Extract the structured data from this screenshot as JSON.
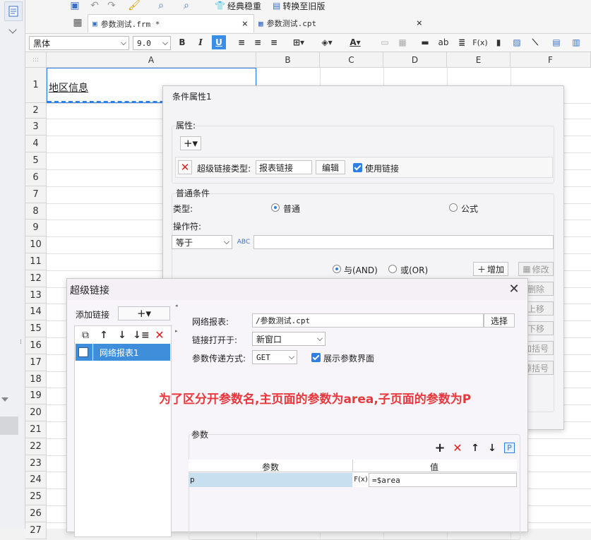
{
  "toolbar": {
    "stable_label": "经典稳重",
    "convert_label": "转换至旧版",
    "tabs": [
      {
        "label": "参数测试.frm *",
        "close": "×"
      },
      {
        "label": "参数测试.cpt",
        "close": "×"
      }
    ]
  },
  "format_bar": {
    "font": "黑体",
    "size": "9.0",
    "bold": "B",
    "italic": "I",
    "underline": "U",
    "ab": "ab",
    "fx": "F(x)"
  },
  "sheet": {
    "corner": ":::",
    "columns": [
      "A",
      "B",
      "C",
      "D",
      "E",
      "F"
    ],
    "rows": [
      "1",
      "2",
      "3",
      "4",
      "5",
      "6",
      "7",
      "8",
      "9",
      "10",
      "11",
      "12",
      "13",
      "14",
      "15",
      "16",
      "17",
      "18",
      "19",
      "20",
      "21",
      "22",
      "23",
      "24",
      "25",
      "26",
      "27"
    ],
    "cell_a1": "地区信息"
  },
  "condition_dialog": {
    "title": "条件属性1",
    "property_label": "属性:",
    "link_type_label": "超级链接类型:",
    "link_type_value": "报表链接",
    "edit_button": "编辑",
    "use_link_label": "使用链接",
    "normal_condition_label": "普通条件",
    "type_label": "类型:",
    "normal_option": "普通",
    "formula_option": "公式",
    "operator_label": "操作符:",
    "operator_value": "等于",
    "and_option": "与(AND)",
    "or_option": "或(OR)",
    "add_button": "增加",
    "modify_button": "修改",
    "delete_button": "删除",
    "up_button": "上移",
    "down_button": "下移",
    "add_bracket_button": "加括号",
    "remove_bracket_button": "掉括号"
  },
  "hyperlink_dialog": {
    "title": "超级链接",
    "add_link_label": "添加链接",
    "list_items": [
      "网络报表1"
    ],
    "network_report_label": "网络报表:",
    "network_report_value": "/参数测试.cpt",
    "select_button": "选择",
    "open_in_label": "链接打开于:",
    "open_in_value": "新窗口",
    "param_method_label": "参数传递方式:",
    "param_method_value": "GET",
    "show_param_label": "展示参数界面",
    "annotation": "为了区分开参数名,主页面的参数为area,子页面的参数为P",
    "params_label": "参数",
    "param_table": {
      "headers": [
        "参数",
        "值"
      ],
      "rows": [
        {
          "name": "p",
          "fx": "F(x)",
          "value": "=$area"
        }
      ]
    }
  },
  "colors": {
    "accent": "#2d7fe3",
    "annotation": "#e8383d",
    "delete_red": "#e02020"
  }
}
